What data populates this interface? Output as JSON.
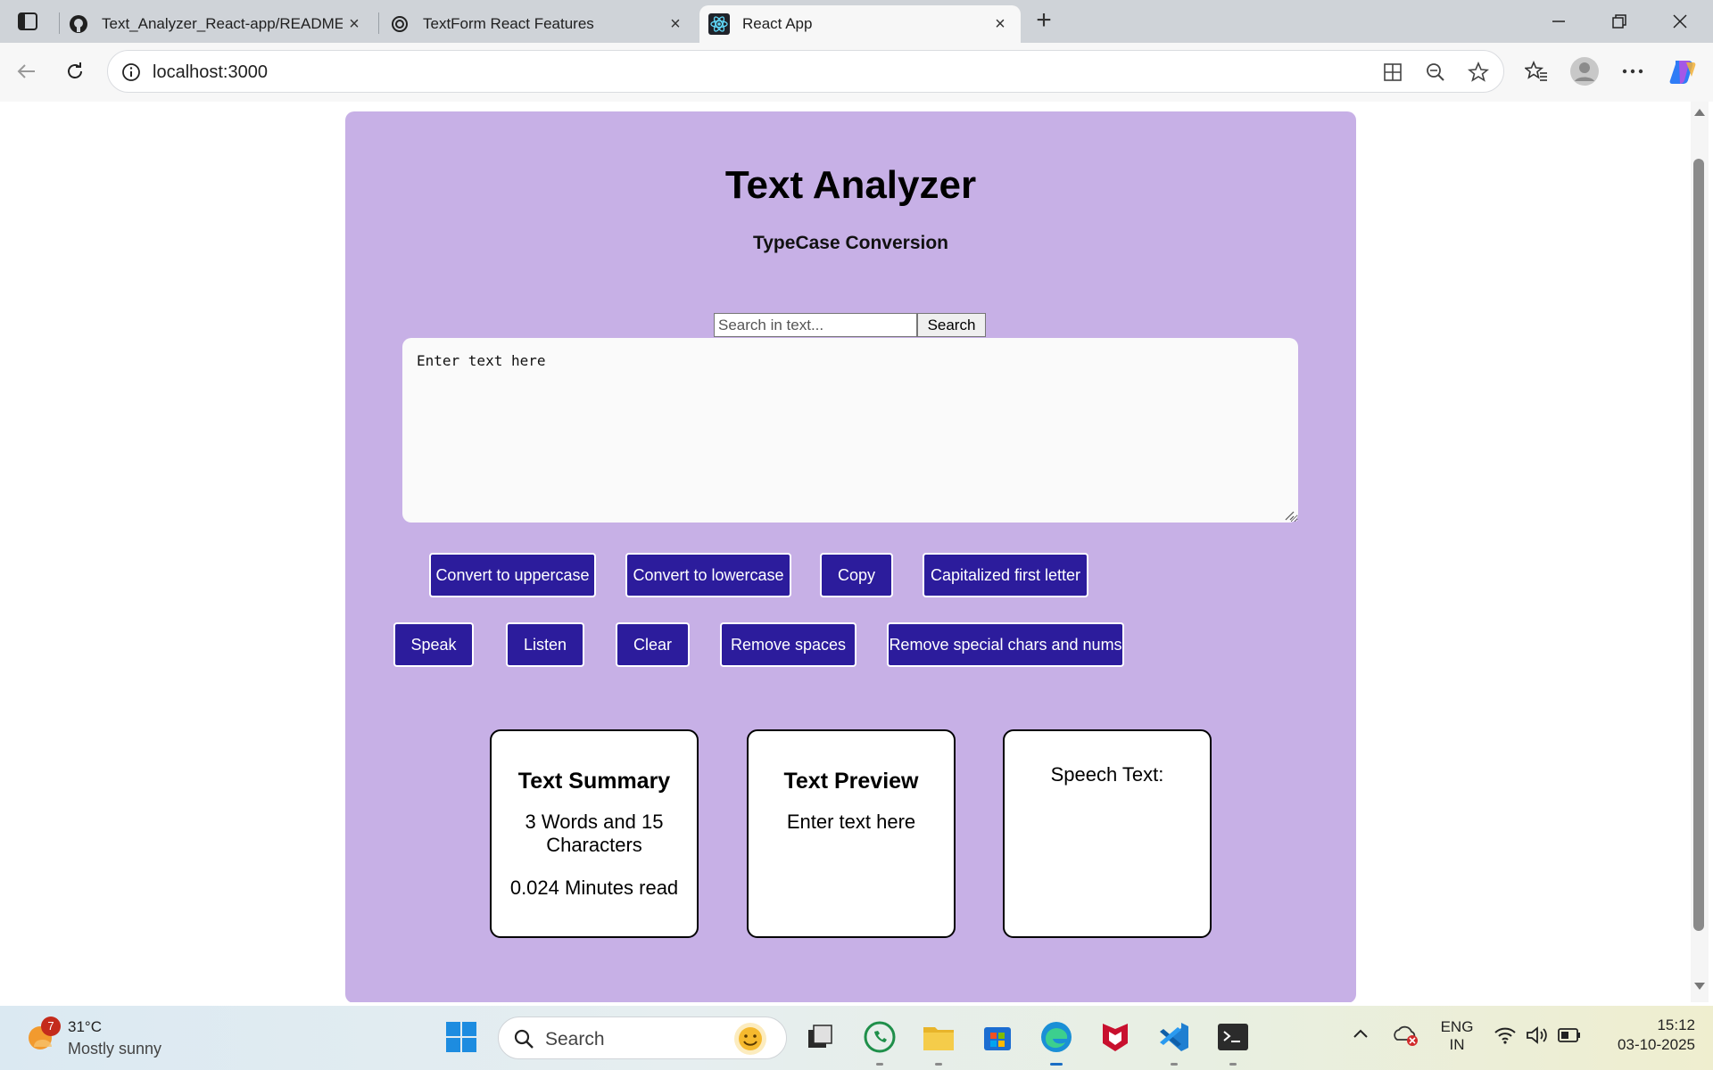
{
  "browser": {
    "tabs": [
      {
        "title": "Text_Analyzer_React-app/README",
        "favicon": "github-icon"
      },
      {
        "title": "TextForm React Features",
        "favicon": "chatgpt-icon"
      },
      {
        "title": "React App",
        "favicon": "react-icon",
        "active": true
      }
    ],
    "url": "localhost:3000"
  },
  "app": {
    "title": "Text Analyzer",
    "subtitle": "TypeCase Conversion",
    "search": {
      "placeholder": "Search in text...",
      "button": "Search"
    },
    "textarea_value": "Enter text here",
    "buttons_row1": [
      "Convert to uppercase",
      "Convert to lowercase",
      "Copy",
      "Capitalized first letter"
    ],
    "buttons_row2": [
      "Speak",
      "Listen",
      "Clear",
      "Remove spaces",
      "Remove special chars and nums"
    ],
    "summary": {
      "title": "Text Summary",
      "counts": "3 Words and 15 Characters",
      "read_time": "0.024 Minutes read"
    },
    "preview": {
      "title": "Text Preview",
      "text": "Enter text here"
    },
    "speech": {
      "label": "Speech Text:"
    },
    "colors": {
      "panel": "#c7b0e6",
      "button": "#2c1c9c",
      "button_text": "#ffffff"
    }
  },
  "taskbar": {
    "weather": {
      "badge": "7",
      "temp": "31°C",
      "condition": "Mostly sunny"
    },
    "search_label": "Search",
    "lang": [
      "ENG",
      "IN"
    ],
    "time": "15:12",
    "date": "03-10-2025"
  }
}
